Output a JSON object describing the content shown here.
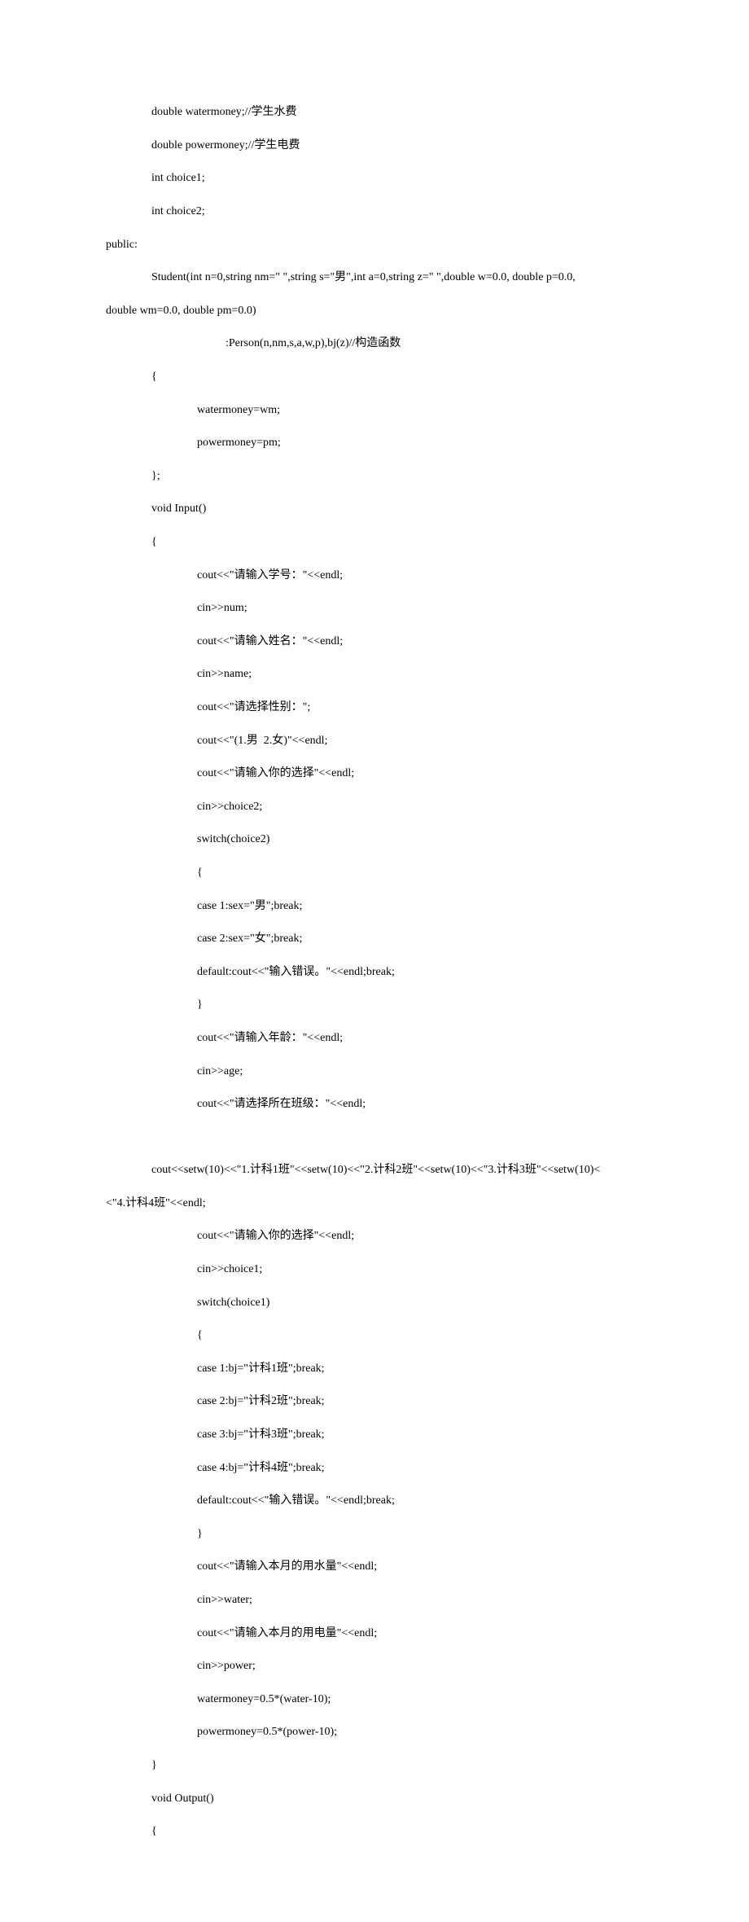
{
  "lines": {
    "l1": "\t\tdouble watermoney;//学生水费",
    "l2": "\t\tdouble powermoney;//学生电费",
    "l3": "\t\tint choice1;",
    "l4": "\t\tint choice2;",
    "l5": "public:",
    "l6": "\t\tStudent(int n=0,string nm=\" \",string s=\"男\",int a=0,string z=\" \",double w=0.0, double p=0.0,",
    "l7": "double wm=0.0, double pm=0.0)",
    "l8": "\t\t\t\t          :Person(n,nm,s,a,w,p),bj(z)//构造函数",
    "l9": "\t\t{",
    "l10": "\t\t\t\twatermoney=wm;",
    "l11": "\t\t\t\tpowermoney=pm;",
    "l12": "\t\t};",
    "l13": "\t\tvoid Input()",
    "l14": "\t\t{",
    "l15": "\t\t\t\tcout<<\"请输入学号：\"<<endl;",
    "l16": "\t\t\t\tcin>>num;",
    "l17": "\t\t\t\tcout<<\"请输入姓名：\"<<endl;",
    "l18": "\t\t\t\tcin>>name;",
    "l19": "\t\t\t\tcout<<\"请选择性别：\";",
    "l20": "\t\t\t\tcout<<\"(1.男  2.女)\"<<endl;",
    "l21": "\t\t\t\tcout<<\"请输入你的选择\"<<endl;",
    "l22": "\t\t\t\tcin>>choice2;",
    "l23": "\t\t\t\tswitch(choice2)",
    "l24": "\t\t\t\t{",
    "l25": "\t\t\t\tcase 1:sex=\"男\";break;",
    "l26": "\t\t\t\tcase 2:sex=\"女\";break;",
    "l27": "\t\t\t\tdefault:cout<<\"输入错误。\"<<endl;break;",
    "l28": "\t\t\t\t}",
    "l29": "\t\t\t\tcout<<\"请输入年龄：\"<<endl;",
    "l30": "\t\t\t\tcin>>age;",
    "l31": "\t\t\t\tcout<<\"请选择所在班级：\"<<endl;",
    "l32": "\t",
    "l33": "\t\tcout<<setw(10)<<\"1.计科1班\"<<setw(10)<<\"2.计科2班\"<<setw(10)<<\"3.计科3班\"<<setw(10)<",
    "l34": "<\"4.计科4班\"<<endl;",
    "l35": "\t\t\t\tcout<<\"请输入你的选择\"<<endl;",
    "l36": "\t\t\t\tcin>>choice1;",
    "l37": "\t\t\t\tswitch(choice1)",
    "l38": "\t\t\t\t{",
    "l39": "\t\t\t\tcase 1:bj=\"计科1班\";break;",
    "l40": "\t\t\t\tcase 2:bj=\"计科2班\";break;",
    "l41": "\t\t\t\tcase 3:bj=\"计科3班\";break;",
    "l42": "\t\t\t\tcase 4:bj=\"计科4班\";break;",
    "l43": "\t\t\t\tdefault:cout<<\"输入错误。\"<<endl;break;",
    "l44": "\t\t\t\t}",
    "l45": "\t\t\t\tcout<<\"请输入本月的用水量\"<<endl;",
    "l46": "\t\t\t\tcin>>water;",
    "l47": "\t\t\t\tcout<<\"请输入本月的用电量\"<<endl;",
    "l48": "\t\t\t\tcin>>power;",
    "l49": "\t\t\t\twatermoney=0.5*(water-10);",
    "l50": "\t\t\t\tpowermoney=0.5*(power-10);",
    "l51": "\t\t}",
    "l52": "\t\tvoid Output()",
    "l53": "\t\t{"
  }
}
